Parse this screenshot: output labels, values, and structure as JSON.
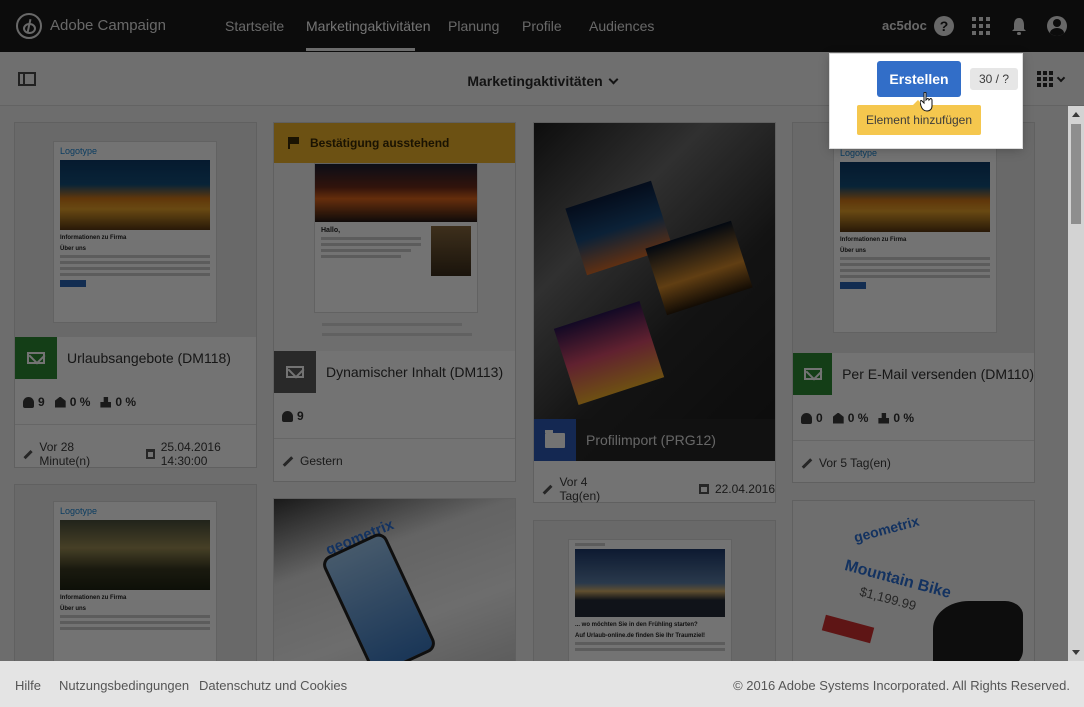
{
  "app": {
    "title": "Adobe Campaign"
  },
  "nav": {
    "items": [
      {
        "label": "Startseite"
      },
      {
        "label": "Marketingaktivitäten",
        "active": true
      },
      {
        "label": "Planung"
      },
      {
        "label": "Profile"
      },
      {
        "label": "Audiences"
      }
    ],
    "user": "ac5doc",
    "help_glyph": "?"
  },
  "subheader": {
    "title": "Marketingaktivitäten"
  },
  "toolbar": {
    "create_label": "Erstellen",
    "counter": "30 / ?",
    "tooltip": "Element hinzufügen",
    "accent": "#326ec8",
    "tooltip_color": "#f5c74e"
  },
  "cards": [
    {
      "title": "Urlaubsangebote (DM118)",
      "type_icon": "email-icon",
      "stats": {
        "recipients": "9",
        "opens": "0 %",
        "clicks": "0 %"
      },
      "modified": "Vor 28 Minute(n)",
      "date": "25.04.2016 14:30:00",
      "email": {
        "logo_1": "Logo",
        "logo_2": "type",
        "heading": "Informationen zu Firma",
        "sub": "Über uns"
      }
    },
    {
      "title": "Dynamischer Inhalt (DM113)",
      "type_icon": "email-icon",
      "status": "Bestätigung ausstehend",
      "stats": {
        "recipients": "9"
      },
      "modified": "Gestern",
      "email": {
        "greeting": "Hallo,"
      }
    },
    {
      "title": "Profilimport (PRG12)",
      "type_icon": "folder-icon",
      "modified": "Vor 4 Tag(en)",
      "date": "22.04.2016"
    },
    {
      "title": "Per E-Mail versenden (DM110)",
      "type_icon": "email-icon",
      "stats": {
        "recipients": "0",
        "opens": "0 %",
        "clicks": "0 %"
      },
      "modified": "Vor 5 Tag(en)",
      "email": {
        "logo_1": "Logo",
        "logo_2": "type",
        "heading": "Informationen zu Firma",
        "sub": "Über uns"
      }
    },
    {
      "email": {
        "logo_1": "Logo",
        "logo_2": "type",
        "heading": "Informationen zu Firma",
        "sub": "Über uns"
      }
    },
    {
      "thumb_text": "geometrix"
    },
    {
      "email": {
        "line_1": "... wo möchten Sie in den Frühling starten?",
        "line_2": "Auf Urlaub-online.de finden Sie Ihr Traumziel!"
      }
    },
    {
      "thumb_text": "geometrix",
      "promo_title": "Mountain Bike",
      "promo_price": "$1,199.99"
    }
  ],
  "footer": {
    "links": [
      "Hilfe",
      "Nutzungsbedingungen",
      "Datenschutz und Cookies"
    ],
    "copyright": "© 2016 Adobe Systems Incorporated. All Rights Reserved."
  }
}
